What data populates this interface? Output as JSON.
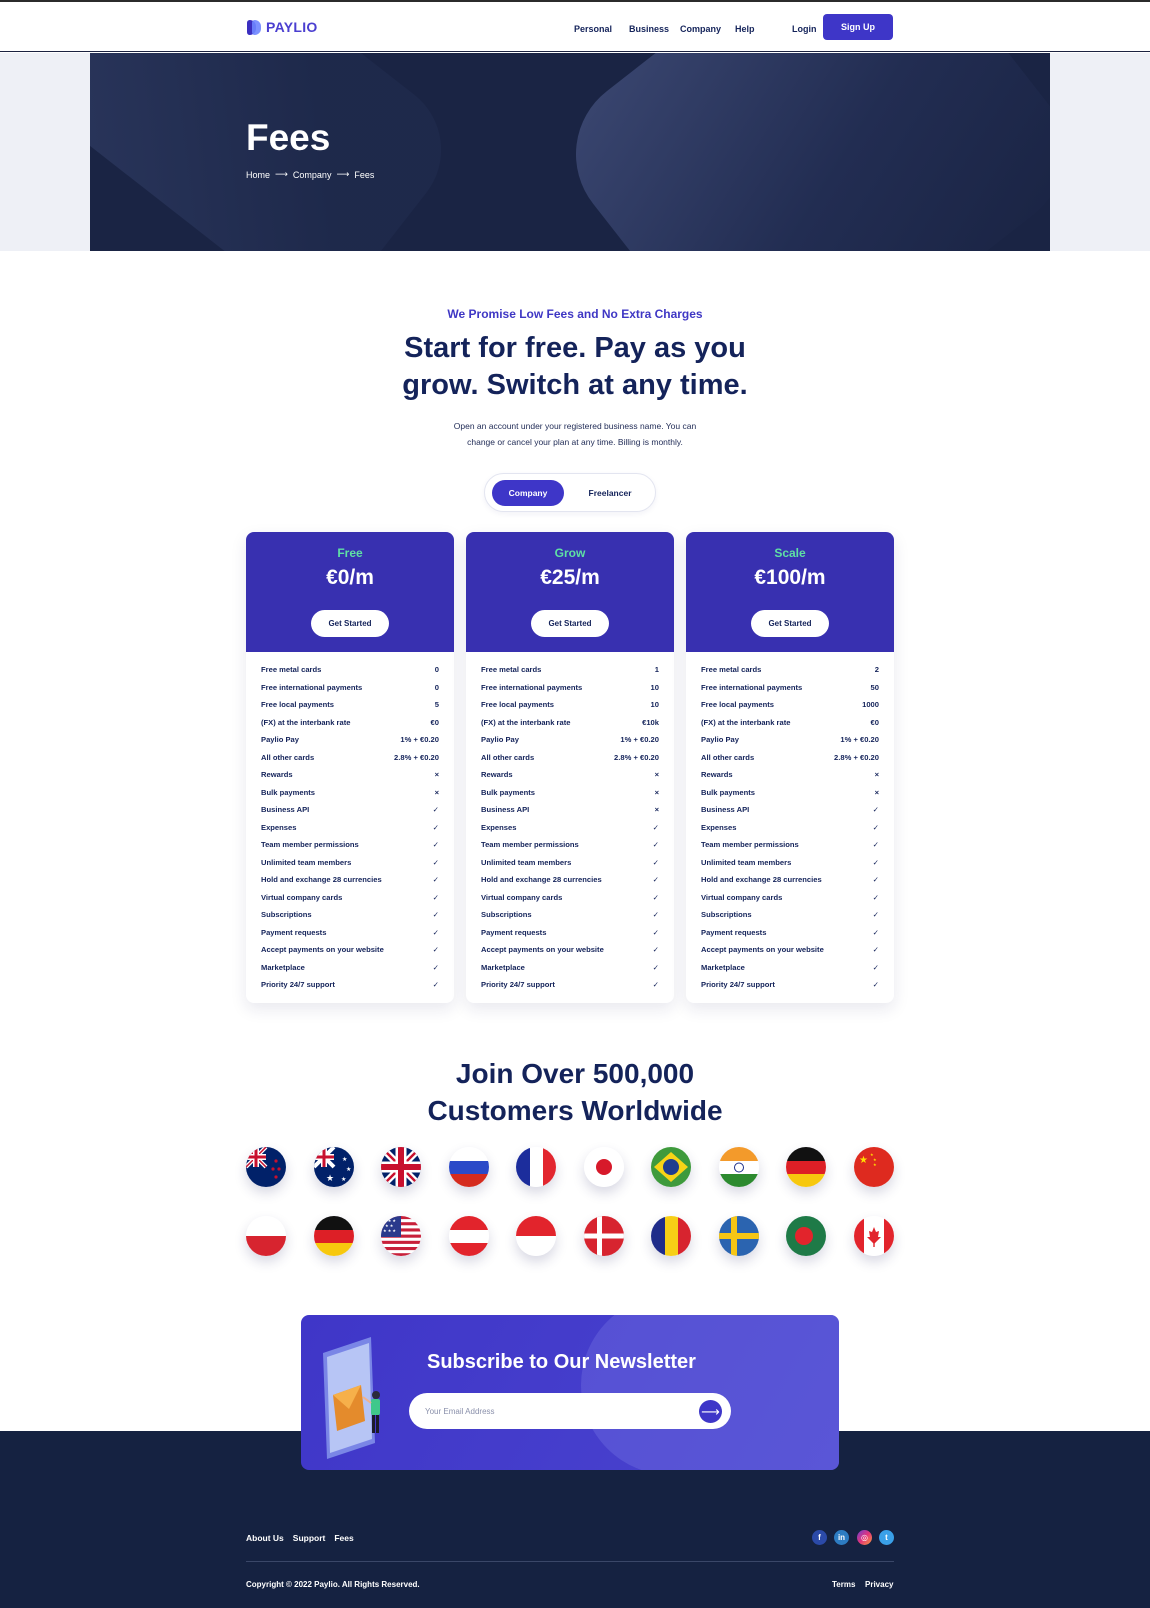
{
  "header": {
    "brand": "PAYLIO",
    "nav": [
      "Personal",
      "Business",
      "Company",
      "Help"
    ],
    "login": "Login",
    "signup": "Sign Up"
  },
  "hero": {
    "title": "Fees",
    "breadcrumb": [
      "Home",
      "Company",
      "Fees"
    ]
  },
  "intro": {
    "eyebrow": "We Promise Low Fees and No Extra Charges",
    "headline_line1": "Start for free. Pay as you",
    "headline_line2": "grow. Switch at any time.",
    "sub_line1": "Open an account under your registered business name. You can",
    "sub_line2": "change or cancel your plan at any time. Billing is monthly."
  },
  "toggle": {
    "options": [
      "Company",
      "Freelancer"
    ],
    "selected": "Company"
  },
  "plans": [
    {
      "name": "Free",
      "price": "€0/m",
      "cta": "Get Started",
      "rows": [
        [
          "Free metal cards",
          "0"
        ],
        [
          "Free international payments",
          "0"
        ],
        [
          "Free local payments",
          "5"
        ],
        [
          "(FX) at the interbank rate",
          "€0"
        ],
        [
          "Paylio Pay",
          "1% + €0.20"
        ],
        [
          "All other cards",
          "2.8% + €0.20"
        ],
        [
          "Rewards",
          "×"
        ],
        [
          "Bulk payments",
          "×"
        ],
        [
          "Business API",
          "✓"
        ],
        [
          "Expenses",
          "✓"
        ],
        [
          "Team member permissions",
          "✓"
        ],
        [
          "Unlimited team members",
          "✓"
        ],
        [
          "Hold and exchange 28 currencies",
          "✓"
        ],
        [
          "Virtual company cards",
          "✓"
        ],
        [
          "Subscriptions",
          "✓"
        ],
        [
          "Payment requests",
          "✓"
        ],
        [
          "Accept payments on your website",
          "✓"
        ],
        [
          "Marketplace",
          "✓"
        ],
        [
          "Priority 24/7 support",
          "✓"
        ]
      ]
    },
    {
      "name": "Grow",
      "price": "€25/m",
      "cta": "Get Started",
      "rows": [
        [
          "Free metal cards",
          "1"
        ],
        [
          "Free international payments",
          "10"
        ],
        [
          "Free local payments",
          "10"
        ],
        [
          "(FX) at the interbank rate",
          "€10k"
        ],
        [
          "Paylio Pay",
          "1% + €0.20"
        ],
        [
          "All other cards",
          "2.8% + €0.20"
        ],
        [
          "Rewards",
          "×"
        ],
        [
          "Bulk payments",
          "×"
        ],
        [
          "Business API",
          "×"
        ],
        [
          "Expenses",
          "✓"
        ],
        [
          "Team member permissions",
          "✓"
        ],
        [
          "Unlimited team members",
          "✓"
        ],
        [
          "Hold and exchange 28 currencies",
          "✓"
        ],
        [
          "Virtual company cards",
          "✓"
        ],
        [
          "Subscriptions",
          "✓"
        ],
        [
          "Payment requests",
          "✓"
        ],
        [
          "Accept payments on your website",
          "✓"
        ],
        [
          "Marketplace",
          "✓"
        ],
        [
          "Priority 24/7 support",
          "✓"
        ]
      ]
    },
    {
      "name": "Scale",
      "price": "€100/m",
      "cta": "Get Started",
      "rows": [
        [
          "Free metal cards",
          "2"
        ],
        [
          "Free international payments",
          "50"
        ],
        [
          "Free local payments",
          "1000"
        ],
        [
          "(FX) at the interbank rate",
          "€0"
        ],
        [
          "Paylio Pay",
          "1% + €0.20"
        ],
        [
          "All other cards",
          "2.8% + €0.20"
        ],
        [
          "Rewards",
          "×"
        ],
        [
          "Bulk payments",
          "×"
        ],
        [
          "Business API",
          "✓"
        ],
        [
          "Expenses",
          "✓"
        ],
        [
          "Team member permissions",
          "✓"
        ],
        [
          "Unlimited team members",
          "✓"
        ],
        [
          "Hold and exchange 28 currencies",
          "✓"
        ],
        [
          "Virtual company cards",
          "✓"
        ],
        [
          "Subscriptions",
          "✓"
        ],
        [
          "Payment requests",
          "✓"
        ],
        [
          "Accept payments on your website",
          "✓"
        ],
        [
          "Marketplace",
          "✓"
        ],
        [
          "Priority 24/7 support",
          "✓"
        ]
      ]
    }
  ],
  "customers": {
    "headline_line1": "Join Over 500,000",
    "headline_line2": "Customers Worldwide",
    "flags": [
      "new-zealand",
      "australia",
      "united-kingdom",
      "russia",
      "france",
      "japan",
      "brazil",
      "india",
      "germany",
      "china",
      "poland",
      "germany",
      "united-states",
      "austria",
      "indonesia",
      "denmark",
      "romania",
      "sweden",
      "bangladesh",
      "canada"
    ]
  },
  "newsletter": {
    "title": "Subscribe to Our Newsletter",
    "placeholder": "Your Email Address"
  },
  "footer": {
    "links": [
      "About Us",
      "Support",
      "Fees"
    ],
    "social": [
      "facebook-icon",
      "linkedin-icon",
      "instagram-icon",
      "twitter-icon"
    ],
    "copyright": "Copyright © 2022 Paylio. All Rights Reserved.",
    "terms": "Terms",
    "privacy": "Privacy"
  },
  "colors": {
    "brand": "#3e36c8",
    "navy": "#14235a",
    "footer": "#152241",
    "plan_name": "#5fe0a4"
  }
}
